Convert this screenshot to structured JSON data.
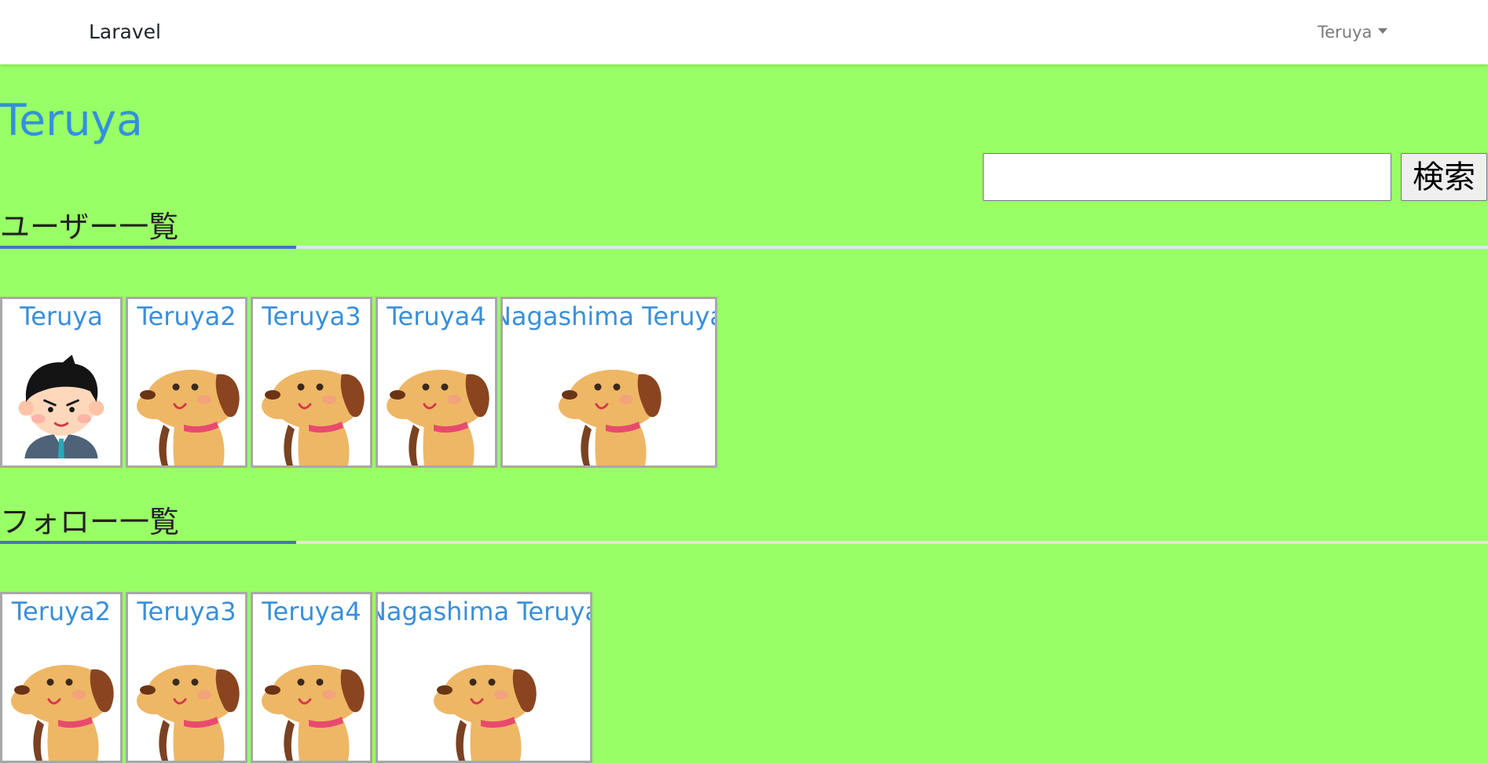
{
  "navbar": {
    "brand": "Laravel",
    "user_menu_label": "Teruya"
  },
  "page_title": "Teruya",
  "search": {
    "value": "",
    "placeholder": "",
    "button_label": "検索"
  },
  "users_section": {
    "title": "ユーザー一覧",
    "cards": [
      {
        "name": "Teruya",
        "image": "businessman-avatar"
      },
      {
        "name": "Teruya2",
        "image": "dog-avatar"
      },
      {
        "name": "Teruya3",
        "image": "dog-avatar"
      },
      {
        "name": "Teruya4",
        "image": "dog-avatar"
      },
      {
        "name": "Nagashima Teruya",
        "image": "dog-avatar"
      }
    ]
  },
  "follow_section": {
    "title": "フォロー一覧",
    "cards": [
      {
        "name": "Teruya2",
        "image": "dog-avatar"
      },
      {
        "name": "Teruya3",
        "image": "dog-avatar"
      },
      {
        "name": "Teruya4",
        "image": "dog-avatar"
      },
      {
        "name": "Nagashima Teruya",
        "image": "dog-avatar"
      }
    ]
  },
  "colors": {
    "page_background": "#99ff66",
    "link_blue": "#3490dc",
    "rule_accent": "#4a72c0",
    "rule_light": "#dde6e8"
  }
}
